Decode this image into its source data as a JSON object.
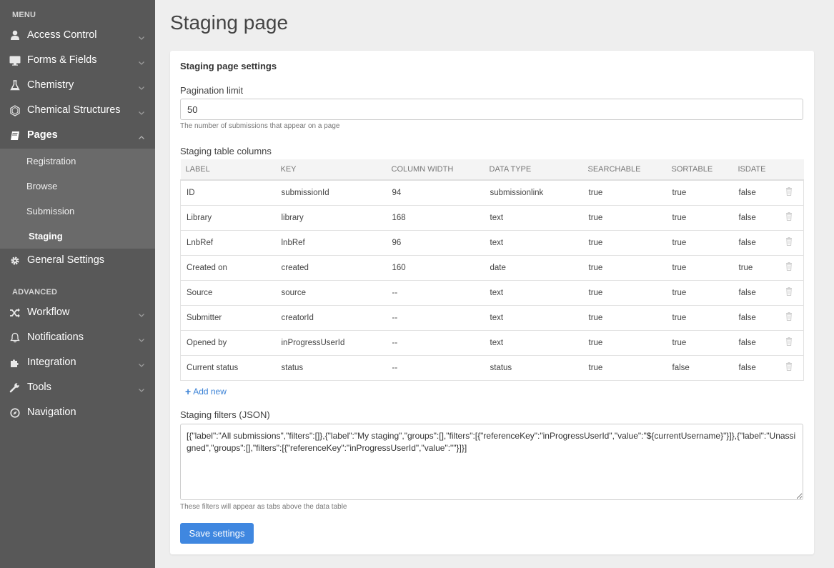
{
  "sidebar": {
    "menu_label": "MENU",
    "advanced_label": "ADVANCED",
    "items": [
      {
        "label": "Access Control",
        "icon": "user-icon"
      },
      {
        "label": "Forms & Fields",
        "icon": "monitor-icon"
      },
      {
        "label": "Chemistry",
        "icon": "flask-icon"
      },
      {
        "label": "Chemical Structures",
        "icon": "hexagon-icon"
      },
      {
        "label": "Pages",
        "icon": "book-icon"
      },
      {
        "label": "General Settings",
        "icon": "gear-icon"
      }
    ],
    "sub_items": [
      {
        "label": "Registration"
      },
      {
        "label": "Browse"
      },
      {
        "label": "Submission"
      },
      {
        "label": "Staging"
      }
    ],
    "advanced_items": [
      {
        "label": "Workflow",
        "icon": "shuffle-icon"
      },
      {
        "label": "Notifications",
        "icon": "bell-icon"
      },
      {
        "label": "Integration",
        "icon": "puzzle-icon"
      },
      {
        "label": "Tools",
        "icon": "wrench-icon"
      },
      {
        "label": "Navigation",
        "icon": "compass-icon"
      }
    ]
  },
  "page": {
    "title": "Staging page"
  },
  "settings": {
    "title": "Staging page settings",
    "pagination_label": "Pagination limit",
    "pagination_value": "50",
    "pagination_help": "The number of submissions that appear on a page",
    "columns_label": "Staging table columns",
    "headers": [
      "LABEL",
      "KEY",
      "COLUMN WIDTH",
      "DATA TYPE",
      "SEARCHABLE",
      "SORTABLE",
      "ISDATE"
    ],
    "rows": [
      [
        "ID",
        "submissionId",
        "94",
        "submissionlink",
        "true",
        "true",
        "false"
      ],
      [
        "Library",
        "library",
        "168",
        "text",
        "true",
        "true",
        "false"
      ],
      [
        "LnbRef",
        "lnbRef",
        "96",
        "text",
        "true",
        "true",
        "false"
      ],
      [
        "Created on",
        "created",
        "160",
        "date",
        "true",
        "true",
        "true"
      ],
      [
        "Source",
        "source",
        "--",
        "text",
        "true",
        "true",
        "false"
      ],
      [
        "Submitter",
        "creatorId",
        "--",
        "text",
        "true",
        "true",
        "false"
      ],
      [
        "Opened by",
        "inProgressUserId",
        "--",
        "text",
        "true",
        "true",
        "false"
      ],
      [
        "Current status",
        "status",
        "--",
        "status",
        "true",
        "false",
        "false"
      ]
    ],
    "add_new_label": "Add new",
    "filters_label": "Staging filters (JSON)",
    "filters_value": "[{\"label\":\"All submissions\",\"filters\":[]},{\"label\":\"My staging\",\"groups\":[],\"filters\":[{\"referenceKey\":\"inProgressUserId\",\"value\":\"${currentUsername}\"}]},{\"label\":\"Unassigned\",\"groups\":[],\"filters\":[{\"referenceKey\":\"inProgressUserId\",\"value\":\"\"}]}]",
    "filters_help": "These filters will appear as tabs above the data table",
    "save_label": "Save settings"
  },
  "colors": {
    "sidebar_bg": "#585858",
    "subnav_bg": "#6a6a6a",
    "accent": "#3f87e0",
    "link": "#3b82d6"
  }
}
